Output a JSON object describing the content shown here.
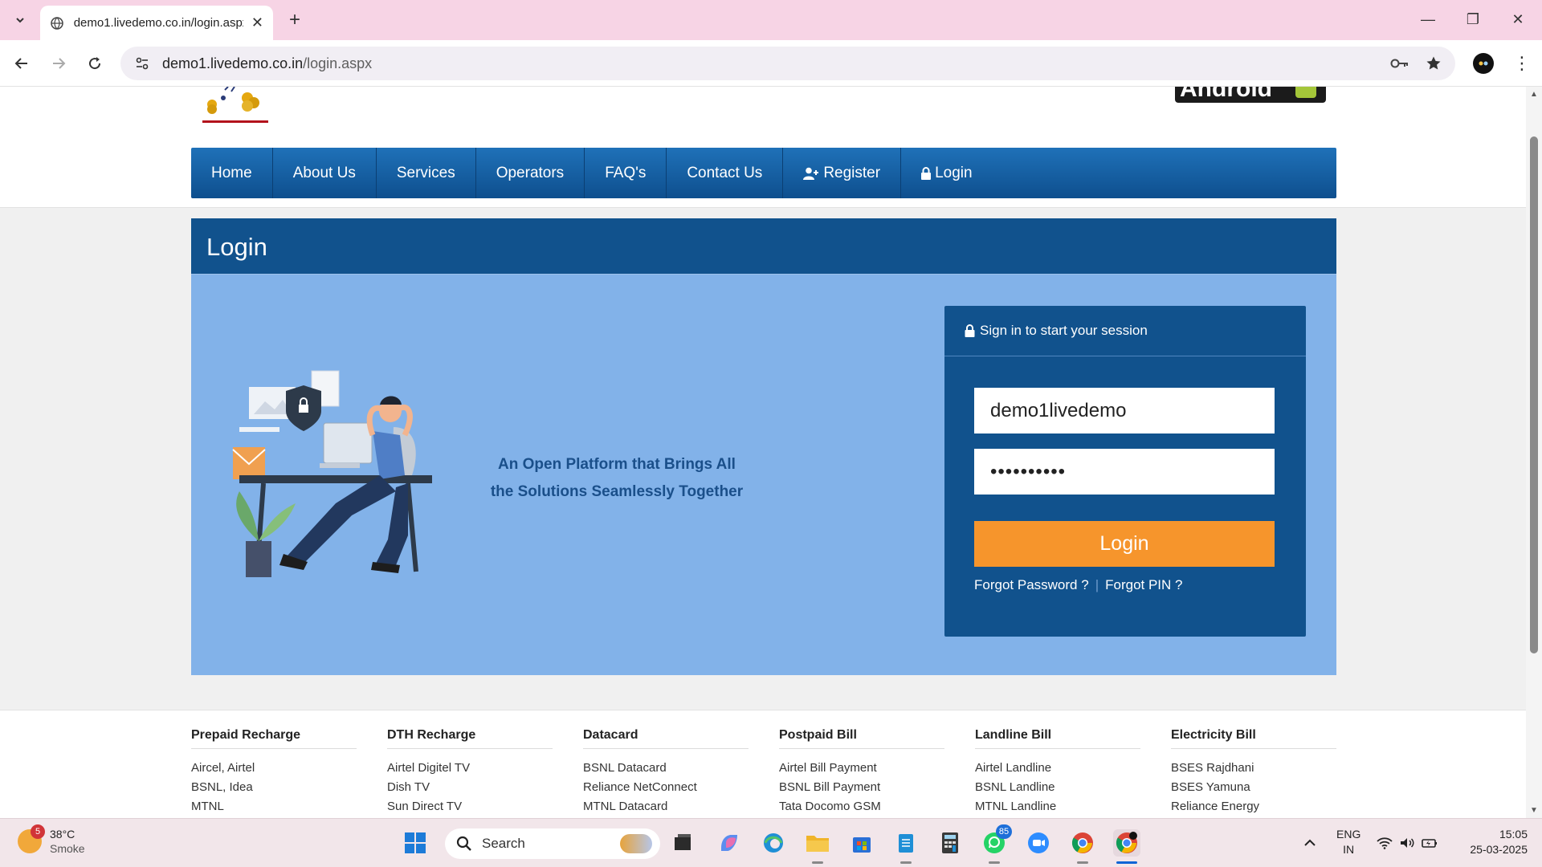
{
  "browser": {
    "tab_title": "demo1.livedemo.co.in/login.aspx",
    "url_host": "demo1.livedemo.co.in",
    "url_path": "/login.aspx"
  },
  "nav": {
    "items": [
      {
        "label": "Home",
        "icon": ""
      },
      {
        "label": "About Us",
        "icon": ""
      },
      {
        "label": "Services",
        "icon": ""
      },
      {
        "label": "Operators",
        "icon": ""
      },
      {
        "label": "FAQ's",
        "icon": ""
      },
      {
        "label": "Contact Us",
        "icon": ""
      },
      {
        "label": "Register",
        "icon": "user-plus-icon"
      },
      {
        "label": "Login",
        "icon": "lock-icon"
      }
    ]
  },
  "page": {
    "heading": "Login",
    "tagline_line1": "An Open Platform that Brings All",
    "tagline_line2": "the Solutions Seamlessly Together"
  },
  "login_form": {
    "header": "Sign in to start your session",
    "username_value": "demo1livedemo",
    "password_value": "••••••••••",
    "submit_label": "Login",
    "forgot_password": "Forgot Password ?",
    "forgot_pin": "Forgot PIN ?"
  },
  "footer": {
    "columns": [
      {
        "title": "Prepaid Recharge",
        "links": [
          "Aircel, Airtel",
          "BSNL, Idea",
          "MTNL"
        ]
      },
      {
        "title": "DTH Recharge",
        "links": [
          "Airtel Digitel TV",
          "Dish TV",
          "Sun Direct TV"
        ]
      },
      {
        "title": "Datacard",
        "links": [
          "BSNL Datacard",
          "Reliance NetConnect",
          "MTNL Datacard"
        ]
      },
      {
        "title": "Postpaid Bill",
        "links": [
          "Airtel Bill Payment",
          "BSNL Bill Payment",
          "Tata Docomo GSM"
        ]
      },
      {
        "title": "Landline Bill",
        "links": [
          "Airtel Landline",
          "BSNL Landline",
          "MTNL Landline"
        ]
      },
      {
        "title": "Electricity Bill",
        "links": [
          "BSES Rajdhani",
          "BSES Yamuna",
          "Reliance Energy"
        ]
      }
    ]
  },
  "taskbar": {
    "weather_badge": "5",
    "temperature": "38°C",
    "condition": "Smoke",
    "search_placeholder": "Search",
    "whatsapp_badge": "85",
    "lang_line1": "ENG",
    "lang_line2": "IN",
    "time": "15:05",
    "date": "25-03-2025"
  },
  "colors": {
    "nav_blue": "#1f71b8",
    "panel_blue": "#11528d",
    "panel_light": "#82b2e9",
    "login_orange": "#f6952c"
  }
}
